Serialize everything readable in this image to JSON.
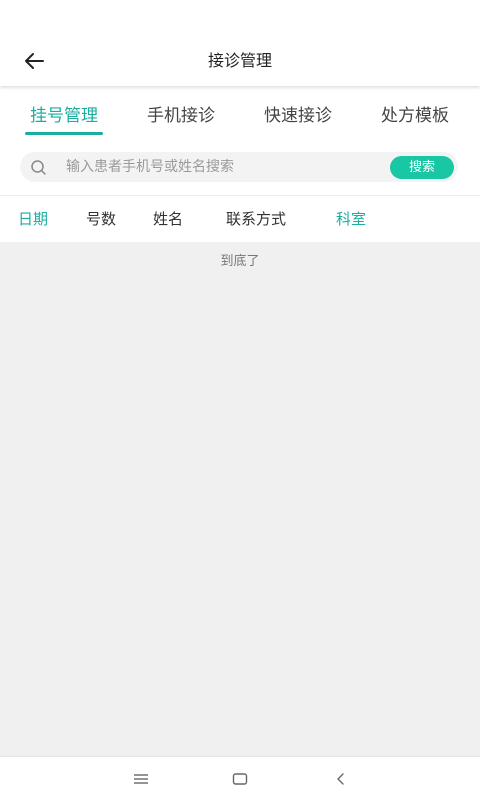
{
  "header": {
    "title": "接诊管理",
    "back_icon": "arrow-left-icon"
  },
  "tabs": [
    {
      "label": "挂号管理",
      "active": true
    },
    {
      "label": "手机接诊",
      "active": false
    },
    {
      "label": "快速接诊",
      "active": false
    },
    {
      "label": "处方模板",
      "active": false
    }
  ],
  "search": {
    "placeholder": "输入患者手机号或姓名搜索",
    "value": "",
    "button_label": "搜索",
    "icon": "search-icon"
  },
  "table": {
    "columns": [
      {
        "label": "日期"
      },
      {
        "label": "号数"
      },
      {
        "label": "姓名"
      },
      {
        "label": "联系方式"
      },
      {
        "label": "科室"
      }
    ]
  },
  "list": {
    "end_text": "到底了"
  },
  "system_nav": {
    "items": [
      "menu-icon",
      "home-icon",
      "back-icon"
    ]
  },
  "colors": {
    "accent": "#1aae9f",
    "button": "#19c7a4",
    "background": "#f0f0f0"
  }
}
